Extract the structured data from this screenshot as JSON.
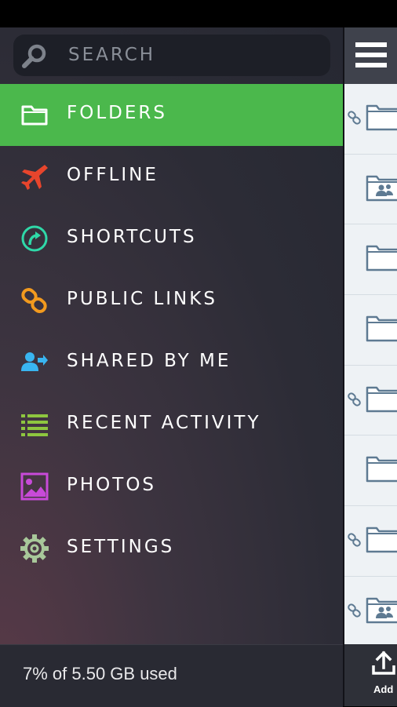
{
  "search": {
    "placeholder": "SEARCH",
    "icon": "search-icon"
  },
  "menu": {
    "items": [
      {
        "label": "FOLDERS",
        "icon": "folder-icon",
        "color": "#ffffff",
        "active": true
      },
      {
        "label": "OFFLINE",
        "icon": "airplane-icon",
        "color": "#e8452c"
      },
      {
        "label": "SHORTCUTS",
        "icon": "shortcut-icon",
        "color": "#2fd8a8"
      },
      {
        "label": "PUBLIC LINKS",
        "icon": "link-icon",
        "color": "#f29a1e"
      },
      {
        "label": "SHARED BY ME",
        "icon": "shared-user-icon",
        "color": "#39b5f0"
      },
      {
        "label": "RECENT ACTIVITY",
        "icon": "list-icon",
        "color": "#8ec63f"
      },
      {
        "label": "PHOTOS",
        "icon": "photo-icon",
        "color": "#c84ad8"
      },
      {
        "label": "SETTINGS",
        "icon": "gear-icon",
        "color": "#a8c89a"
      }
    ]
  },
  "footer": {
    "usage": "7% of 5.50 GB used"
  },
  "right_pane": {
    "rows": [
      {
        "linked": true,
        "shared": false
      },
      {
        "linked": false,
        "shared": true
      },
      {
        "linked": false,
        "shared": false
      },
      {
        "linked": false,
        "shared": false
      },
      {
        "linked": true,
        "shared": false
      },
      {
        "linked": false,
        "shared": false
      },
      {
        "linked": true,
        "shared": false
      },
      {
        "linked": true,
        "shared": true
      }
    ],
    "add_label": "Add"
  },
  "colors": {
    "active": "#4bb84c",
    "folder_outline": "#5e7a92"
  }
}
